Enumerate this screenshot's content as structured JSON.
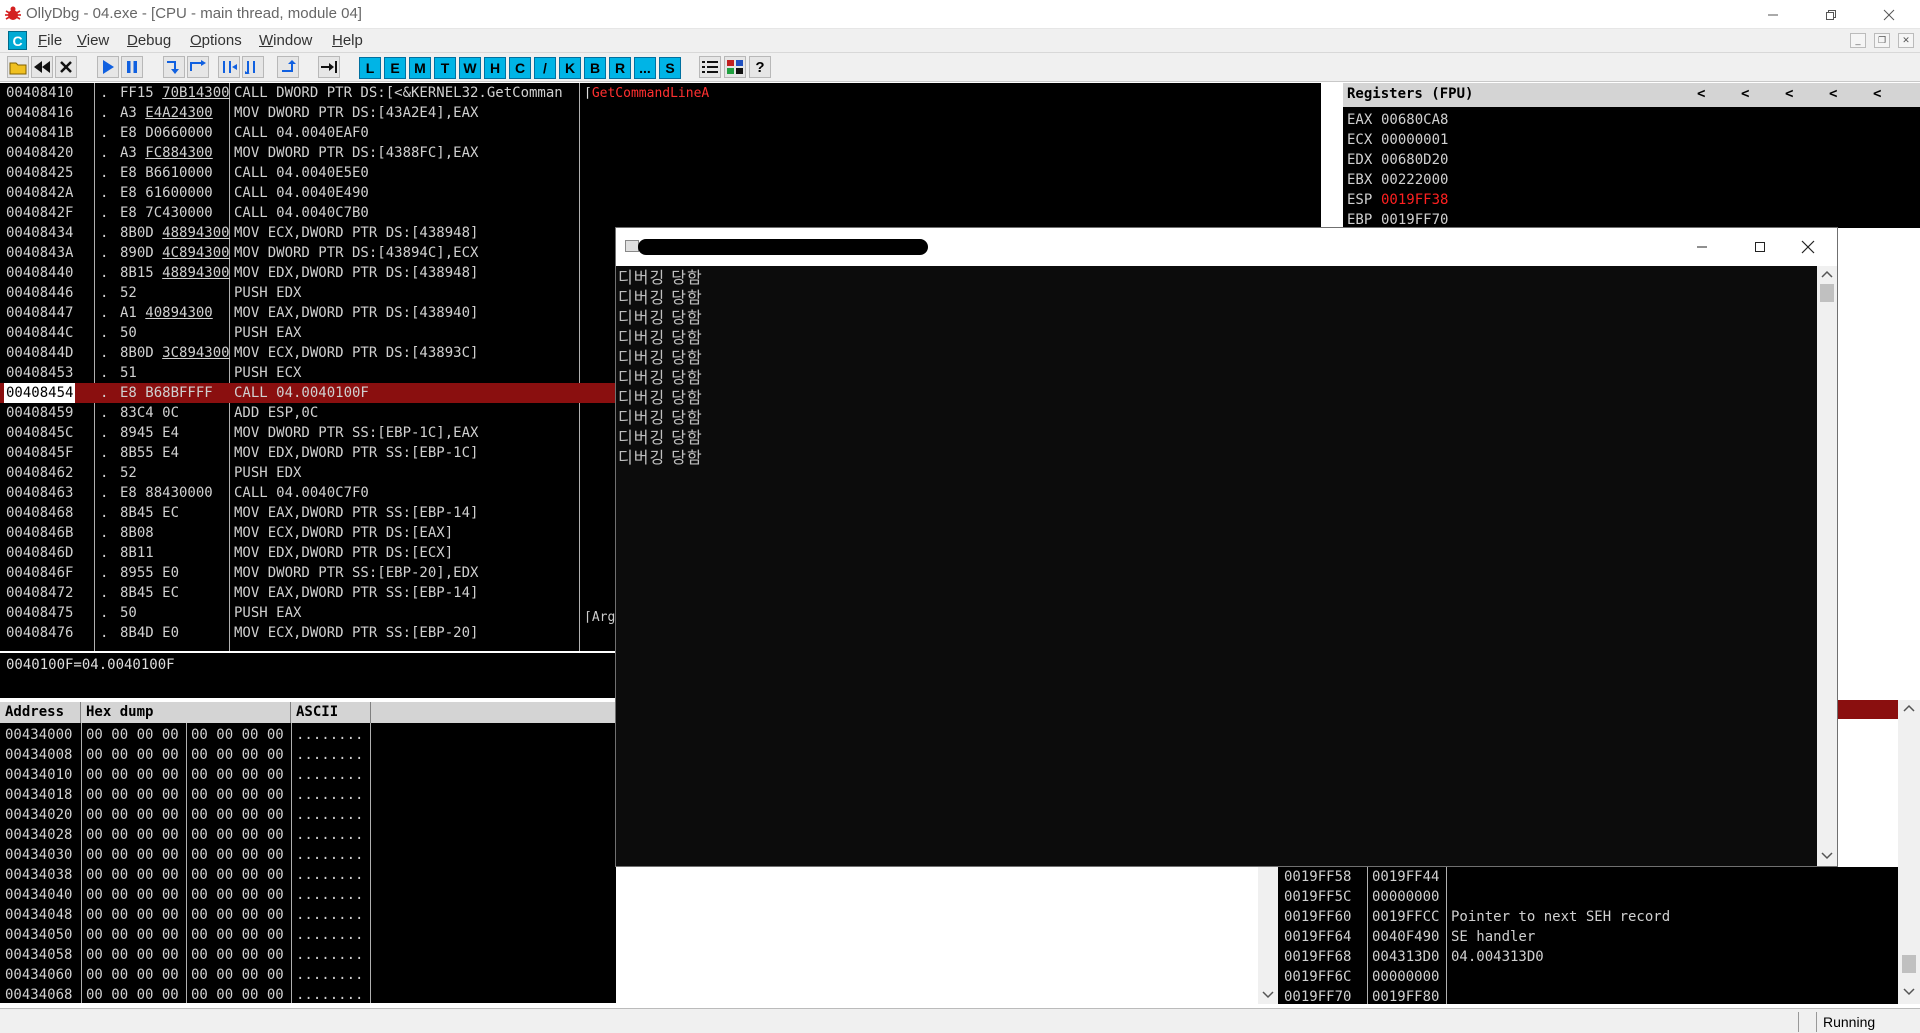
{
  "window": {
    "title": "OllyDbg - 04.exe - [CPU - main thread, module 04]"
  },
  "menu": [
    {
      "label": "File",
      "accel": "F",
      "rest": "ile"
    },
    {
      "label": "View",
      "accel": "V",
      "rest": "iew"
    },
    {
      "label": "Debug",
      "accel": "D",
      "rest": "ebug"
    },
    {
      "label": "Options",
      "accel": "O",
      "rest": "ptions"
    },
    {
      "label": "Window",
      "accel": "W",
      "rest": "indow"
    },
    {
      "label": "Help",
      "accel": "H",
      "rest": "elp"
    }
  ],
  "mdi_icon": "C",
  "toolbar_letters": [
    "L",
    "E",
    "M",
    "T",
    "W",
    "H",
    "C",
    "/",
    "K",
    "B",
    "R",
    "...",
    "S"
  ],
  "disasm": [
    {
      "addr": "00408410",
      "mark": ".",
      "hex": "FF15 70B14300",
      "ul": "70B14300",
      "cmd": "CALL DWORD PTR DS:[<&KERNEL32.GetComman"
    },
    {
      "addr": "00408416",
      "mark": ".",
      "hex": "A3 E4A24300",
      "ul": "E4A24300",
      "cmd": "MOV DWORD PTR DS:[43A2E4],EAX"
    },
    {
      "addr": "0040841B",
      "mark": ".",
      "hex": "E8 D0660000",
      "ul": "",
      "cmd": "CALL 04.0040EAF0"
    },
    {
      "addr": "00408420",
      "mark": ".",
      "hex": "A3 FC884300",
      "ul": "FC884300",
      "cmd": "MOV DWORD PTR DS:[4388FC],EAX"
    },
    {
      "addr": "00408425",
      "mark": ".",
      "hex": "E8 B6610000",
      "ul": "",
      "cmd": "CALL 04.0040E5E0"
    },
    {
      "addr": "0040842A",
      "mark": ".",
      "hex": "E8 61600000",
      "ul": "",
      "cmd": "CALL 04.0040E490"
    },
    {
      "addr": "0040842F",
      "mark": ".",
      "hex": "E8 7C430000",
      "ul": "",
      "cmd": "CALL 04.0040C7B0"
    },
    {
      "addr": "00408434",
      "mark": ".",
      "hex": "8B0D 48894300",
      "ul": "48894300",
      "cmd": "MOV ECX,DWORD PTR DS:[438948]"
    },
    {
      "addr": "0040843A",
      "mark": ".",
      "hex": "890D 4C894300",
      "ul": "4C894300",
      "cmd": "MOV DWORD PTR DS:[43894C],ECX"
    },
    {
      "addr": "00408440",
      "mark": ".",
      "hex": "8B15 48894300",
      "ul": "48894300",
      "cmd": "MOV EDX,DWORD PTR DS:[438948]"
    },
    {
      "addr": "00408446",
      "mark": ".",
      "hex": "52",
      "ul": "",
      "cmd": "PUSH EDX"
    },
    {
      "addr": "00408447",
      "mark": ".",
      "hex": "A1 40894300",
      "ul": "40894300",
      "cmd": "MOV EAX,DWORD PTR DS:[438940]"
    },
    {
      "addr": "0040844C",
      "mark": ".",
      "hex": "50",
      "ul": "",
      "cmd": "PUSH EAX"
    },
    {
      "addr": "0040844D",
      "mark": ".",
      "hex": "8B0D 3C894300",
      "ul": "3C894300",
      "cmd": "MOV ECX,DWORD PTR DS:[43893C]"
    },
    {
      "addr": "00408453",
      "mark": ".",
      "hex": "51",
      "ul": "",
      "cmd": "PUSH ECX"
    },
    {
      "addr": "00408454",
      "mark": ".",
      "hex": "E8 B68BFFFF",
      "ul": "",
      "cmd": "CALL 04.0040100F",
      "selected": true
    },
    {
      "addr": "00408459",
      "mark": ".",
      "hex": "83C4 0C",
      "ul": "",
      "cmd": "ADD ESP,0C"
    },
    {
      "addr": "0040845C",
      "mark": ".",
      "hex": "8945 E4",
      "ul": "",
      "cmd": "MOV DWORD PTR SS:[EBP-1C],EAX"
    },
    {
      "addr": "0040845F",
      "mark": ".",
      "hex": "8B55 E4",
      "ul": "",
      "cmd": "MOV EDX,DWORD PTR SS:[EBP-1C]"
    },
    {
      "addr": "00408462",
      "mark": ".",
      "hex": "52",
      "ul": "",
      "cmd": "PUSH EDX"
    },
    {
      "addr": "00408463",
      "mark": ".",
      "hex": "E8 88430000",
      "ul": "",
      "cmd": "CALL 04.0040C7F0"
    },
    {
      "addr": "00408468",
      "mark": ".",
      "hex": "8B45 EC",
      "ul": "",
      "cmd": "MOV EAX,DWORD PTR SS:[EBP-14]"
    },
    {
      "addr": "0040846B",
      "mark": ".",
      "hex": "8B08",
      "ul": "",
      "cmd": "MOV ECX,DWORD PTR DS:[EAX]"
    },
    {
      "addr": "0040846D",
      "mark": ".",
      "hex": "8B11",
      "ul": "",
      "cmd": "MOV EDX,DWORD PTR DS:[ECX]"
    },
    {
      "addr": "0040846F",
      "mark": ".",
      "hex": "8955 E0",
      "ul": "",
      "cmd": "MOV DWORD PTR SS:[EBP-20],EDX"
    },
    {
      "addr": "00408472",
      "mark": ".",
      "hex": "8B45 EC",
      "ul": "",
      "cmd": "MOV EAX,DWORD PTR SS:[EBP-14]"
    },
    {
      "addr": "00408475",
      "mark": ".",
      "hex": "50",
      "ul": "",
      "cmd": "PUSH EAX"
    },
    {
      "addr": "00408476",
      "mark": ".",
      "hex": "8B4D E0",
      "ul": "",
      "cmd": "MOV ECX,DWORD PTR SS:[EBP-20]"
    }
  ],
  "comments": {
    "first": "GetCommandLineA",
    "arg": "Arg"
  },
  "info_line": "0040100F=04.0040100F",
  "registers": {
    "title": "Registers (FPU)",
    "arrows": [
      "<",
      "<",
      "<",
      "<",
      "<"
    ],
    "rows": [
      {
        "name": "EAX",
        "value": "00680CA8",
        "changed": false
      },
      {
        "name": "ECX",
        "value": "00000001",
        "changed": false
      },
      {
        "name": "EDX",
        "value": "00680D20",
        "changed": false
      },
      {
        "name": "EBX",
        "value": "00222000",
        "changed": false
      },
      {
        "name": "ESP",
        "value": "0019FF38",
        "changed": true
      },
      {
        "name": "EBP",
        "value": "0019FF70",
        "changed": false
      }
    ]
  },
  "dump": {
    "headers": [
      "Address",
      "Hex dump",
      "ASCII"
    ],
    "rows": [
      {
        "addr": "00434000",
        "a": "00 00 00 00",
        "b": "00 00 00 00",
        "ascii": "........"
      },
      {
        "addr": "00434008",
        "a": "00 00 00 00",
        "b": "00 00 00 00",
        "ascii": "........"
      },
      {
        "addr": "00434010",
        "a": "00 00 00 00",
        "b": "00 00 00 00",
        "ascii": "........"
      },
      {
        "addr": "00434018",
        "a": "00 00 00 00",
        "b": "00 00 00 00",
        "ascii": "........"
      },
      {
        "addr": "00434020",
        "a": "00 00 00 00",
        "b": "00 00 00 00",
        "ascii": "........"
      },
      {
        "addr": "00434028",
        "a": "00 00 00 00",
        "b": "00 00 00 00",
        "ascii": "........"
      },
      {
        "addr": "00434030",
        "a": "00 00 00 00",
        "b": "00 00 00 00",
        "ascii": "........"
      },
      {
        "addr": "00434038",
        "a": "00 00 00 00",
        "b": "00 00 00 00",
        "ascii": "........"
      },
      {
        "addr": "00434040",
        "a": "00 00 00 00",
        "b": "00 00 00 00",
        "ascii": "........"
      },
      {
        "addr": "00434048",
        "a": "00 00 00 00",
        "b": "00 00 00 00",
        "ascii": "........"
      },
      {
        "addr": "00434050",
        "a": "00 00 00 00",
        "b": "00 00 00 00",
        "ascii": "........"
      },
      {
        "addr": "00434058",
        "a": "00 00 00 00",
        "b": "00 00 00 00",
        "ascii": "........"
      },
      {
        "addr": "00434060",
        "a": "00 00 00 00",
        "b": "00 00 00 00",
        "ascii": "........"
      },
      {
        "addr": "00434068",
        "a": "00 00 00 00",
        "b": "00 00 00 00",
        "ascii": "........"
      }
    ]
  },
  "stack": [
    {
      "addr": "0019FF58",
      "value": "0019FF44",
      "comment": ""
    },
    {
      "addr": "0019FF5C",
      "value": "00000000",
      "comment": ""
    },
    {
      "addr": "0019FF60",
      "value": "0019FFCC",
      "comment": "Pointer to next SEH record"
    },
    {
      "addr": "0019FF64",
      "value": "0040F490",
      "comment": "SE handler"
    },
    {
      "addr": "0019FF68",
      "value": "004313D0",
      "comment": "04.004313D0"
    },
    {
      "addr": "0019FF6C",
      "value": "00000000",
      "comment": ""
    },
    {
      "addr": "0019FF70",
      "value": "0019FF80",
      "comment": ""
    }
  ],
  "console": {
    "lines": [
      "디버깅 당함",
      "디버깅 당함",
      "디버깅 당함",
      "디버깅 당함",
      "디버깅 당함",
      "디버깅 당함",
      "디버깅 당함",
      "디버깅 당함",
      "디버깅 당함",
      "디버깅 당함"
    ]
  },
  "status": "Running",
  "colors": {
    "selected_row": "#8a0f0f",
    "changed_register": "#ff2020",
    "toolbar_letter_bg": "#00b4e6"
  }
}
